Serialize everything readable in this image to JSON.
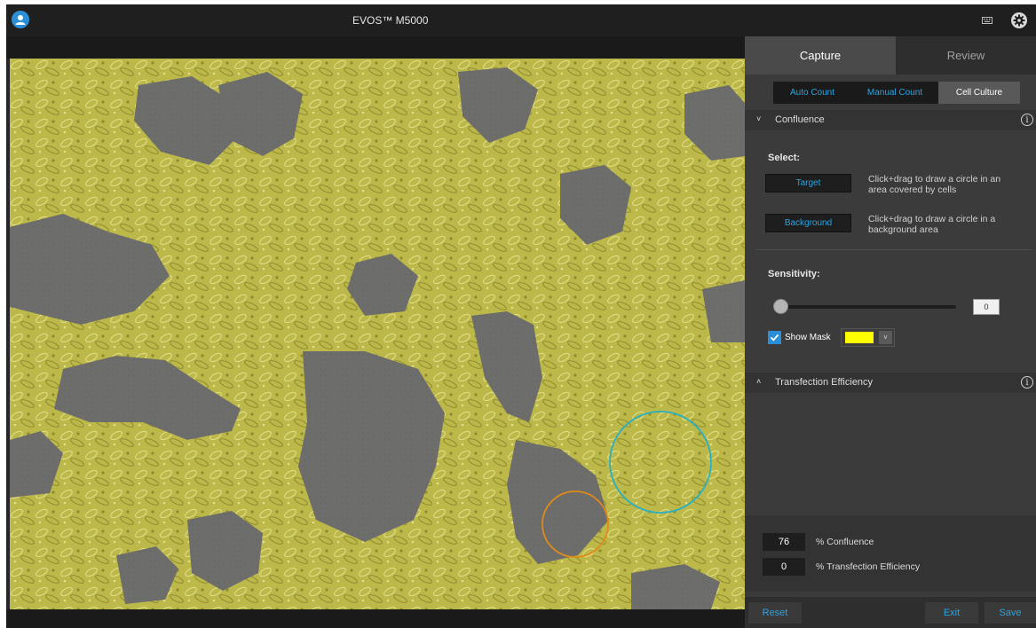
{
  "app": {
    "title": "EVOS™ M5000"
  },
  "tabs": {
    "capture": "Capture",
    "review": "Review"
  },
  "subtabs": {
    "auto_count": "Auto Count",
    "manual_count": "Manual Count",
    "cell_culture": "Cell Culture"
  },
  "confluence": {
    "title": "Confluence",
    "select_label": "Select:",
    "target_button": "Target",
    "target_hint": "Click+drag to draw a circle in an area covered by cells",
    "background_button": "Background",
    "background_hint": "Click+drag to draw a circle in a background area",
    "sensitivity_label": "Sensitivity:",
    "sensitivity_value": "0",
    "sensitivity_level": 0,
    "show_mask_label": "Show Mask",
    "show_mask_checked": true,
    "mask_color": "#ffff00"
  },
  "transfection": {
    "title": "Transfection Efficiency"
  },
  "results": {
    "confluence_value": "76",
    "confluence_label": "% Confluence",
    "transfection_value": "0",
    "transfection_label": "% Transfection Efficiency"
  },
  "footer": {
    "reset": "Reset",
    "exit": "Exit",
    "save": "Save"
  },
  "colors": {
    "accent": "#2aa4e0",
    "mask_overlay": "#bdb84a",
    "background_region": "#6d6d6b",
    "target_circle": "#2ab0c0",
    "background_circle": "#e08a1a"
  },
  "icons": {
    "user": "user-icon",
    "keyboard": "keyboard-icon",
    "settings": "gear-icon",
    "info": "info-icon",
    "collapse": "chevron-down-icon",
    "expand": "chevron-up-icon",
    "check": "checkmark-icon",
    "dropdown": "chevron-down-icon"
  }
}
